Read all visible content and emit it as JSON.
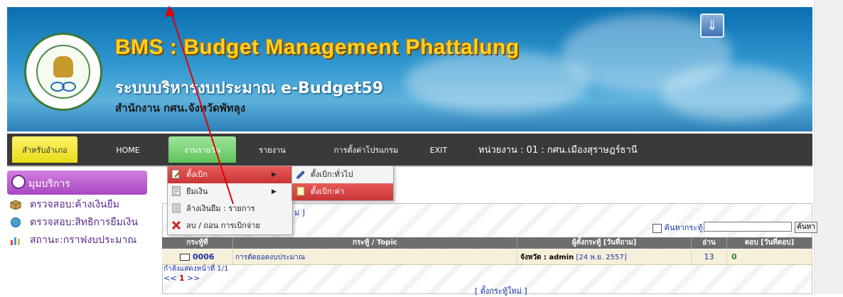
{
  "header": {
    "title_en": "BMS : Budget Management Phattalung",
    "title_th": "ระบบบริหารงบประมาณ e-Budget59",
    "office": "สำนักงาน กศน.จังหวัดพัทลุง",
    "scroll_button_icon": "double-chevron-down-icon"
  },
  "nav": {
    "items": [
      {
        "label": "สำหรับอำเภอ"
      },
      {
        "label": "HOME"
      },
      {
        "label": "งานรายวัน"
      },
      {
        "label": "รายงาน"
      },
      {
        "label": "การตั้งค่าโปรแกรม"
      },
      {
        "label": "EXIT"
      }
    ],
    "unit_label": "หน่วยงาน : 01 : กศน.เมืองสุราษฎร์ธานี"
  },
  "sidebar": {
    "heading": "มุมบริการ",
    "items": [
      {
        "label": "ตรวจสอบ:ค้างเงินยืม",
        "icon": "box-icon"
      },
      {
        "label": "ตรวจสอบ:สิทธิการยืมเงิน",
        "icon": "globe-icon"
      },
      {
        "label": "สถานะ:กราฟงบประมาณ",
        "icon": "chart-icon"
      }
    ]
  },
  "menu": {
    "items": [
      {
        "label": "ตั้งเบิก",
        "icon": "edit-icon"
      },
      {
        "label": "ยืมเงิน",
        "icon": "document-icon"
      },
      {
        "label": "ล้างเงินยืม : รายการ",
        "icon": "list-icon"
      },
      {
        "label": "ลบ / ถอน การเบิกจ่าย",
        "icon": "delete-icon"
      }
    ],
    "submenu": [
      {
        "label": "ตั้งเบิก:ทั่วไป",
        "icon": "pen-icon"
      },
      {
        "label": "ตั้งเบิก:ค่าสาธารณูปโภค",
        "icon": "page-icon"
      }
    ]
  },
  "board": {
    "bracket_link": "ม่ ]",
    "search_label": "ค้นหากระทู้",
    "search_value": "",
    "search_button": "ค้นหา",
    "columns": [
      "กระทู้ที่",
      "กระทู้ / Topic",
      "ผู้ตั้งกระทู้ [วันที่ถาม]",
      "อ่าน",
      "ตอบ [วันที่ตอบ]"
    ],
    "rows": [
      {
        "id": "0006",
        "topic": "การตัดยอดงบประมาณ",
        "poster": "จังหวัด : admin",
        "date": " [24 พ.ย. 2557]",
        "reads": "13",
        "replies": "0"
      }
    ],
    "page_info": "กำลังแสดงหน้าที่ 1/1",
    "pager_prev": "<<",
    "pager_current": "1",
    "pager_next": ">>",
    "new_topic": "[ ตั้งกระทู้ใหม่ ]"
  },
  "colors": {
    "banner_blue": "#2f96cf",
    "title_yellow": "#ffd21f",
    "navbar": "#3a3a3a",
    "nav_active_green": "#5fc45a",
    "nav_yellow": "#e8dc18",
    "menu_active_red": "#c93535",
    "sidebar_purple": "#a848c0",
    "annotation_arrow": "#e00000"
  }
}
